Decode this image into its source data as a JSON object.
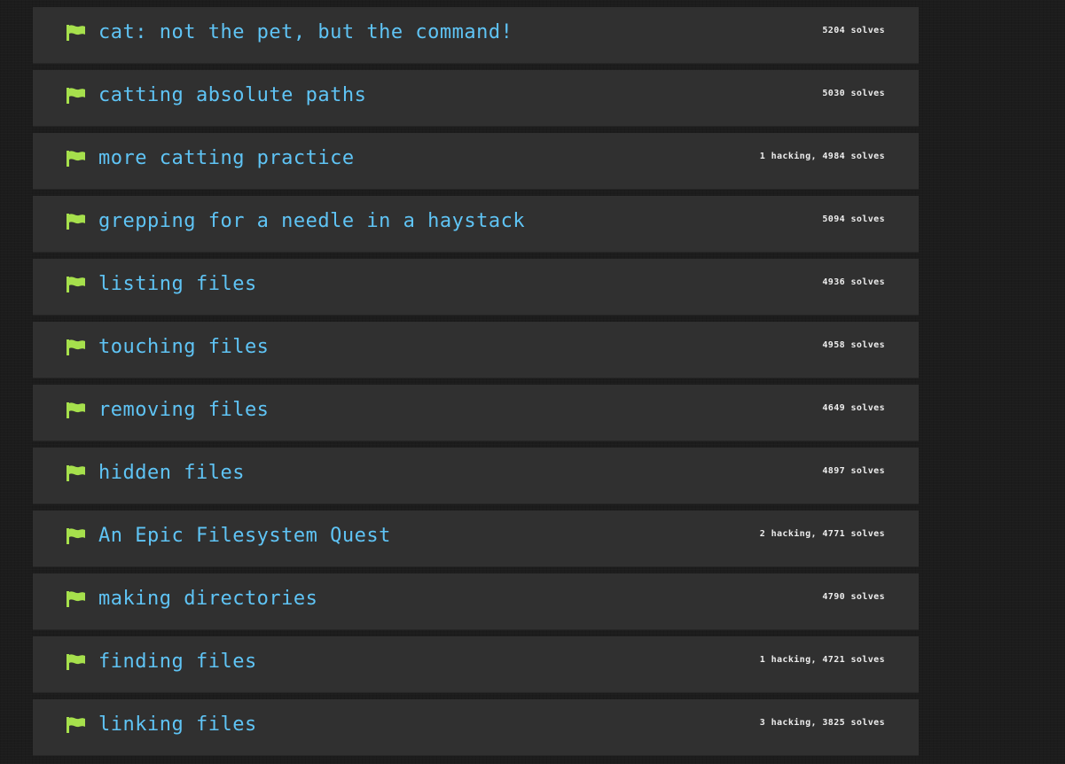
{
  "colors": {
    "background": "#1c1c1c",
    "row_background": "#303030",
    "title_text": "#5fc4f5",
    "flag": "#a6e04c",
    "stats_text": "#ededed"
  },
  "challenges": [
    {
      "icon": "flag-icon",
      "title": "cat: not the pet, but the command!",
      "stats": "5204 solves"
    },
    {
      "icon": "flag-icon",
      "title": "catting absolute paths",
      "stats": "5030 solves"
    },
    {
      "icon": "flag-icon",
      "title": "more catting practice",
      "stats": "1 hacking, 4984 solves"
    },
    {
      "icon": "flag-icon",
      "title": "grepping for a needle in a haystack",
      "stats": "5094 solves"
    },
    {
      "icon": "flag-icon",
      "title": "listing files",
      "stats": "4936 solves"
    },
    {
      "icon": "flag-icon",
      "title": "touching files",
      "stats": "4958 solves"
    },
    {
      "icon": "flag-icon",
      "title": "removing files",
      "stats": "4649 solves"
    },
    {
      "icon": "flag-icon",
      "title": "hidden files",
      "stats": "4897 solves"
    },
    {
      "icon": "flag-icon",
      "title": "An Epic Filesystem Quest",
      "stats": "2 hacking, 4771 solves"
    },
    {
      "icon": "flag-icon",
      "title": "making directories",
      "stats": "4790 solves"
    },
    {
      "icon": "flag-icon",
      "title": "finding files",
      "stats": "1 hacking, 4721 solves"
    },
    {
      "icon": "flag-icon",
      "title": "linking files",
      "stats": "3 hacking, 3825 solves"
    }
  ]
}
